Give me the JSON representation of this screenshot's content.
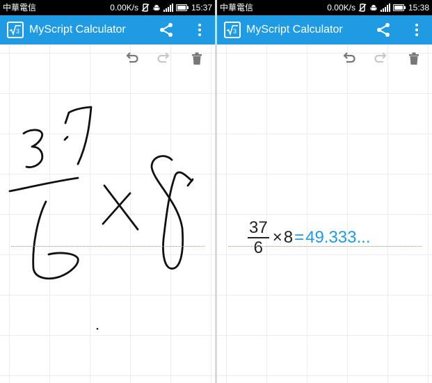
{
  "colors": {
    "app_bar": "#1e9be3",
    "status_bar": "#000000",
    "result_text": "#1e9be3",
    "ink": "#111111",
    "toolbar_active": "#777777",
    "toolbar_disabled": "#c8c8c8"
  },
  "screens": [
    {
      "status_bar": {
        "carrier": "中華電信",
        "speed": "0.00K/s",
        "time": "15:37",
        "icons": [
          "vibrate-off-icon",
          "android-icon",
          "signal-icon",
          "battery-icon"
        ]
      },
      "app_bar": {
        "title": "MyScript Calculator",
        "logo_icon": "sqrt3-logo-icon",
        "actions": [
          "share-icon",
          "overflow-menu-icon"
        ]
      },
      "toolbar": {
        "undo": {
          "icon": "undo-icon",
          "enabled": true
        },
        "redo": {
          "icon": "redo-icon",
          "enabled": false
        },
        "clear": {
          "icon": "trash-icon",
          "enabled": true
        }
      },
      "canvas": {
        "content": "handwriting"
      }
    },
    {
      "status_bar": {
        "carrier": "中華電信",
        "speed": "0.00K/s",
        "time": "15:38",
        "icons": [
          "vibrate-off-icon",
          "android-icon",
          "signal-icon",
          "battery-icon"
        ]
      },
      "app_bar": {
        "title": "MyScript Calculator",
        "logo_icon": "sqrt3-logo-icon",
        "actions": [
          "share-icon",
          "overflow-menu-icon"
        ]
      },
      "toolbar": {
        "undo": {
          "icon": "undo-icon",
          "enabled": true
        },
        "redo": {
          "icon": "redo-icon",
          "enabled": false
        },
        "clear": {
          "icon": "trash-icon",
          "enabled": true
        }
      },
      "canvas": {
        "content": "recognized",
        "expression": {
          "numerator": "37",
          "denominator": "6",
          "operator": "×",
          "operand": "8",
          "equals": "=",
          "result": "49.333..."
        }
      }
    }
  ]
}
